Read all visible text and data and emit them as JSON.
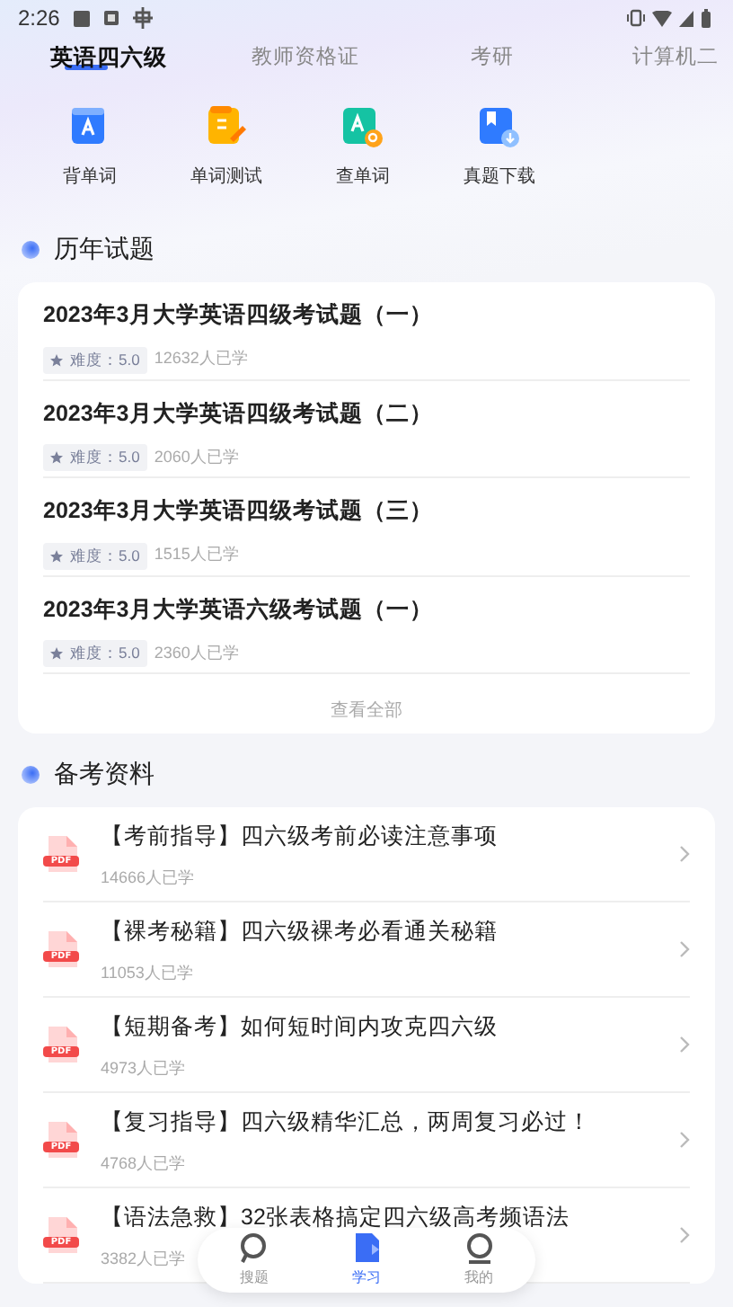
{
  "status_bar": {
    "time": "2:26"
  },
  "tabs": [
    {
      "label": "英语四六级",
      "selected": true
    },
    {
      "label": "教师资格证",
      "selected": false
    },
    {
      "label": "考研",
      "selected": false
    },
    {
      "label": "计算机二",
      "selected": false
    }
  ],
  "shortcuts": [
    {
      "kind": "book",
      "label": "背单词"
    },
    {
      "kind": "test",
      "label": "单词测试"
    },
    {
      "kind": "lookup",
      "label": "查单词"
    },
    {
      "kind": "download",
      "label": "真题下载"
    }
  ],
  "past_exams": {
    "title": "历年试题",
    "more": "查看全部",
    "items": [
      {
        "title": "2023年3月大学英语四级考试题（一）",
        "difficulty": "难度：5.0",
        "learners": "12632人已学"
      },
      {
        "title": "2023年3月大学英语四级考试题（二）",
        "difficulty": "难度：5.0",
        "learners": "2060人已学"
      },
      {
        "title": "2023年3月大学英语四级考试题（三）",
        "difficulty": "难度：5.0",
        "learners": "1515人已学"
      },
      {
        "title": "2023年3月大学英语六级考试题（一）",
        "difficulty": "难度：5.0",
        "learners": "2360人已学"
      }
    ]
  },
  "materials": {
    "title": "备考资料",
    "items": [
      {
        "file_type": "PDF",
        "title": "【考前指导】四六级考前必读注意事项",
        "learners": "14666人已学"
      },
      {
        "file_type": "PDF",
        "title": "【裸考秘籍】四六级裸考必看通关秘籍",
        "learners": "11053人已学"
      },
      {
        "file_type": "PDF",
        "title": "【短期备考】如何短时间内攻克四六级",
        "learners": "4973人已学"
      },
      {
        "file_type": "PDF",
        "title": "【复习指导】四六级精华汇总，两周复习必过！",
        "learners": "4768人已学"
      },
      {
        "file_type": "PDF",
        "title": "【语法急救】32张表格搞定四六级高考频语法",
        "learners": "3382人已学"
      }
    ]
  },
  "bottom_nav": [
    {
      "kind": "search",
      "label": "搜题",
      "selected": false
    },
    {
      "kind": "study",
      "label": "学习",
      "selected": true
    },
    {
      "kind": "profile",
      "label": "我的",
      "selected": false
    }
  ]
}
